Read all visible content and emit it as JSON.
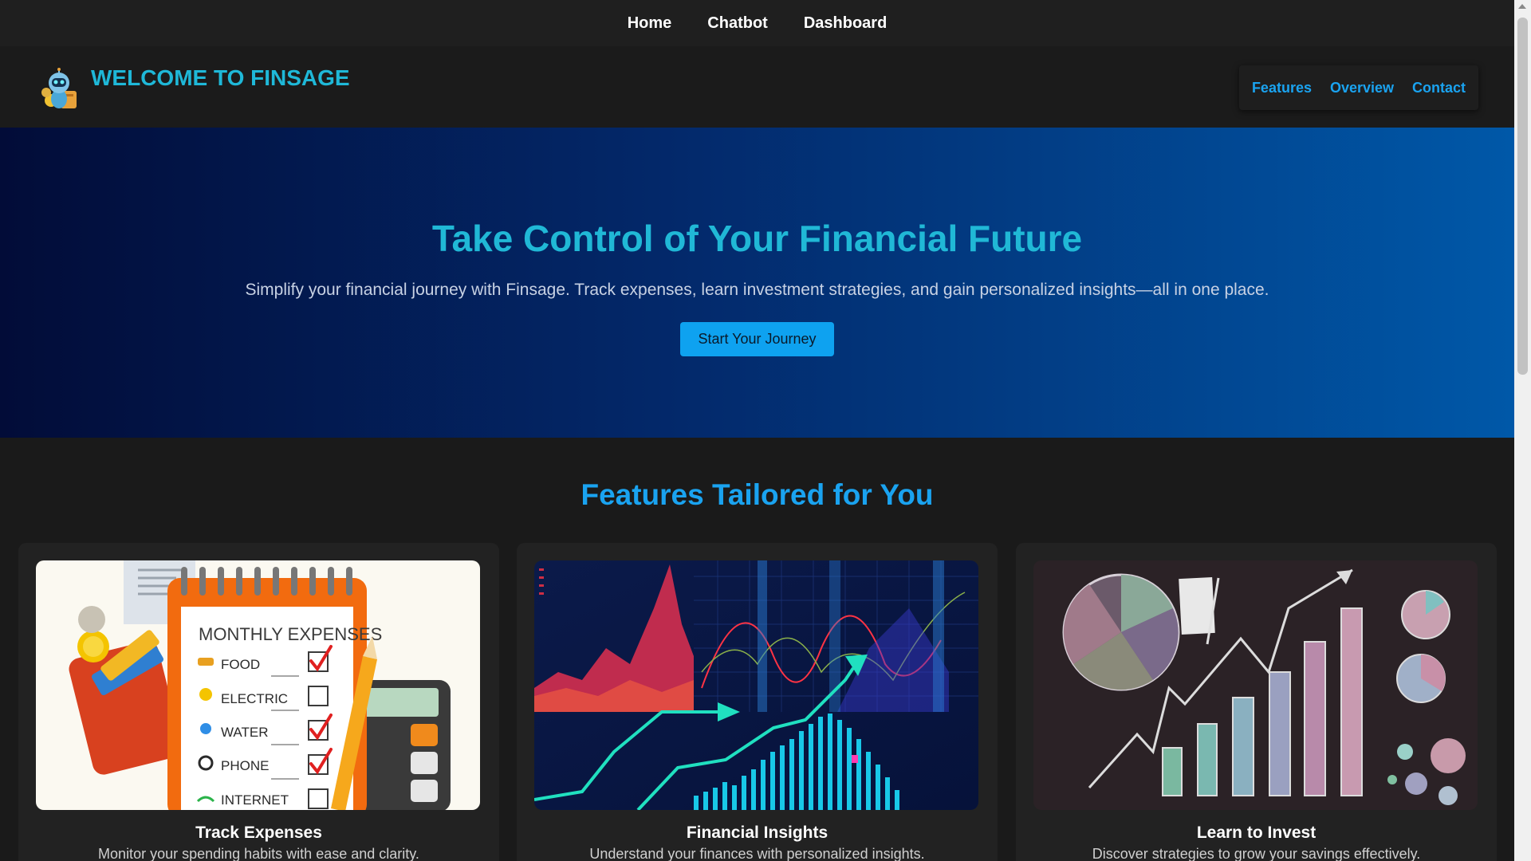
{
  "top_nav": {
    "items": [
      {
        "label": "Home"
      },
      {
        "label": "Chatbot"
      },
      {
        "label": "Dashboard"
      }
    ]
  },
  "header": {
    "logo_icon": "robot-mascot-icon",
    "title": "WELCOME TO FINSAGE",
    "links": [
      {
        "label": "Features"
      },
      {
        "label": "Overview"
      },
      {
        "label": "Contact"
      }
    ]
  },
  "hero": {
    "title": "Take Control of Your Financial Future",
    "subtitle": "Simplify your financial journey with Finsage. Track expenses, learn investment strategies, and gain personalized insights—all in one place.",
    "button_label": "Start Your Journey"
  },
  "features": {
    "title": "Features Tailored for You",
    "cards": [
      {
        "title": "Track Expenses",
        "description": "Monitor your spending habits with ease and clarity.",
        "image": {
          "heading": "MONTHLY EXPENSES",
          "items": [
            {
              "label": "FOOD",
              "checked": true
            },
            {
              "label": "ELECTRIC",
              "checked": false
            },
            {
              "label": "WATER",
              "checked": true
            },
            {
              "label": "PHONE",
              "checked": true
            },
            {
              "label": "INTERNET",
              "checked": false
            }
          ]
        }
      },
      {
        "title": "Financial Insights",
        "description": "Understand your finances with personalized insights."
      },
      {
        "title": "Learn to Invest",
        "description": "Discover strategies to grow your savings effectively."
      }
    ]
  },
  "colors": {
    "accent": "#1aa3f0",
    "brand": "#1fb8d8",
    "button": "#0ea2f0",
    "page_bg": "#1a1a1a"
  }
}
